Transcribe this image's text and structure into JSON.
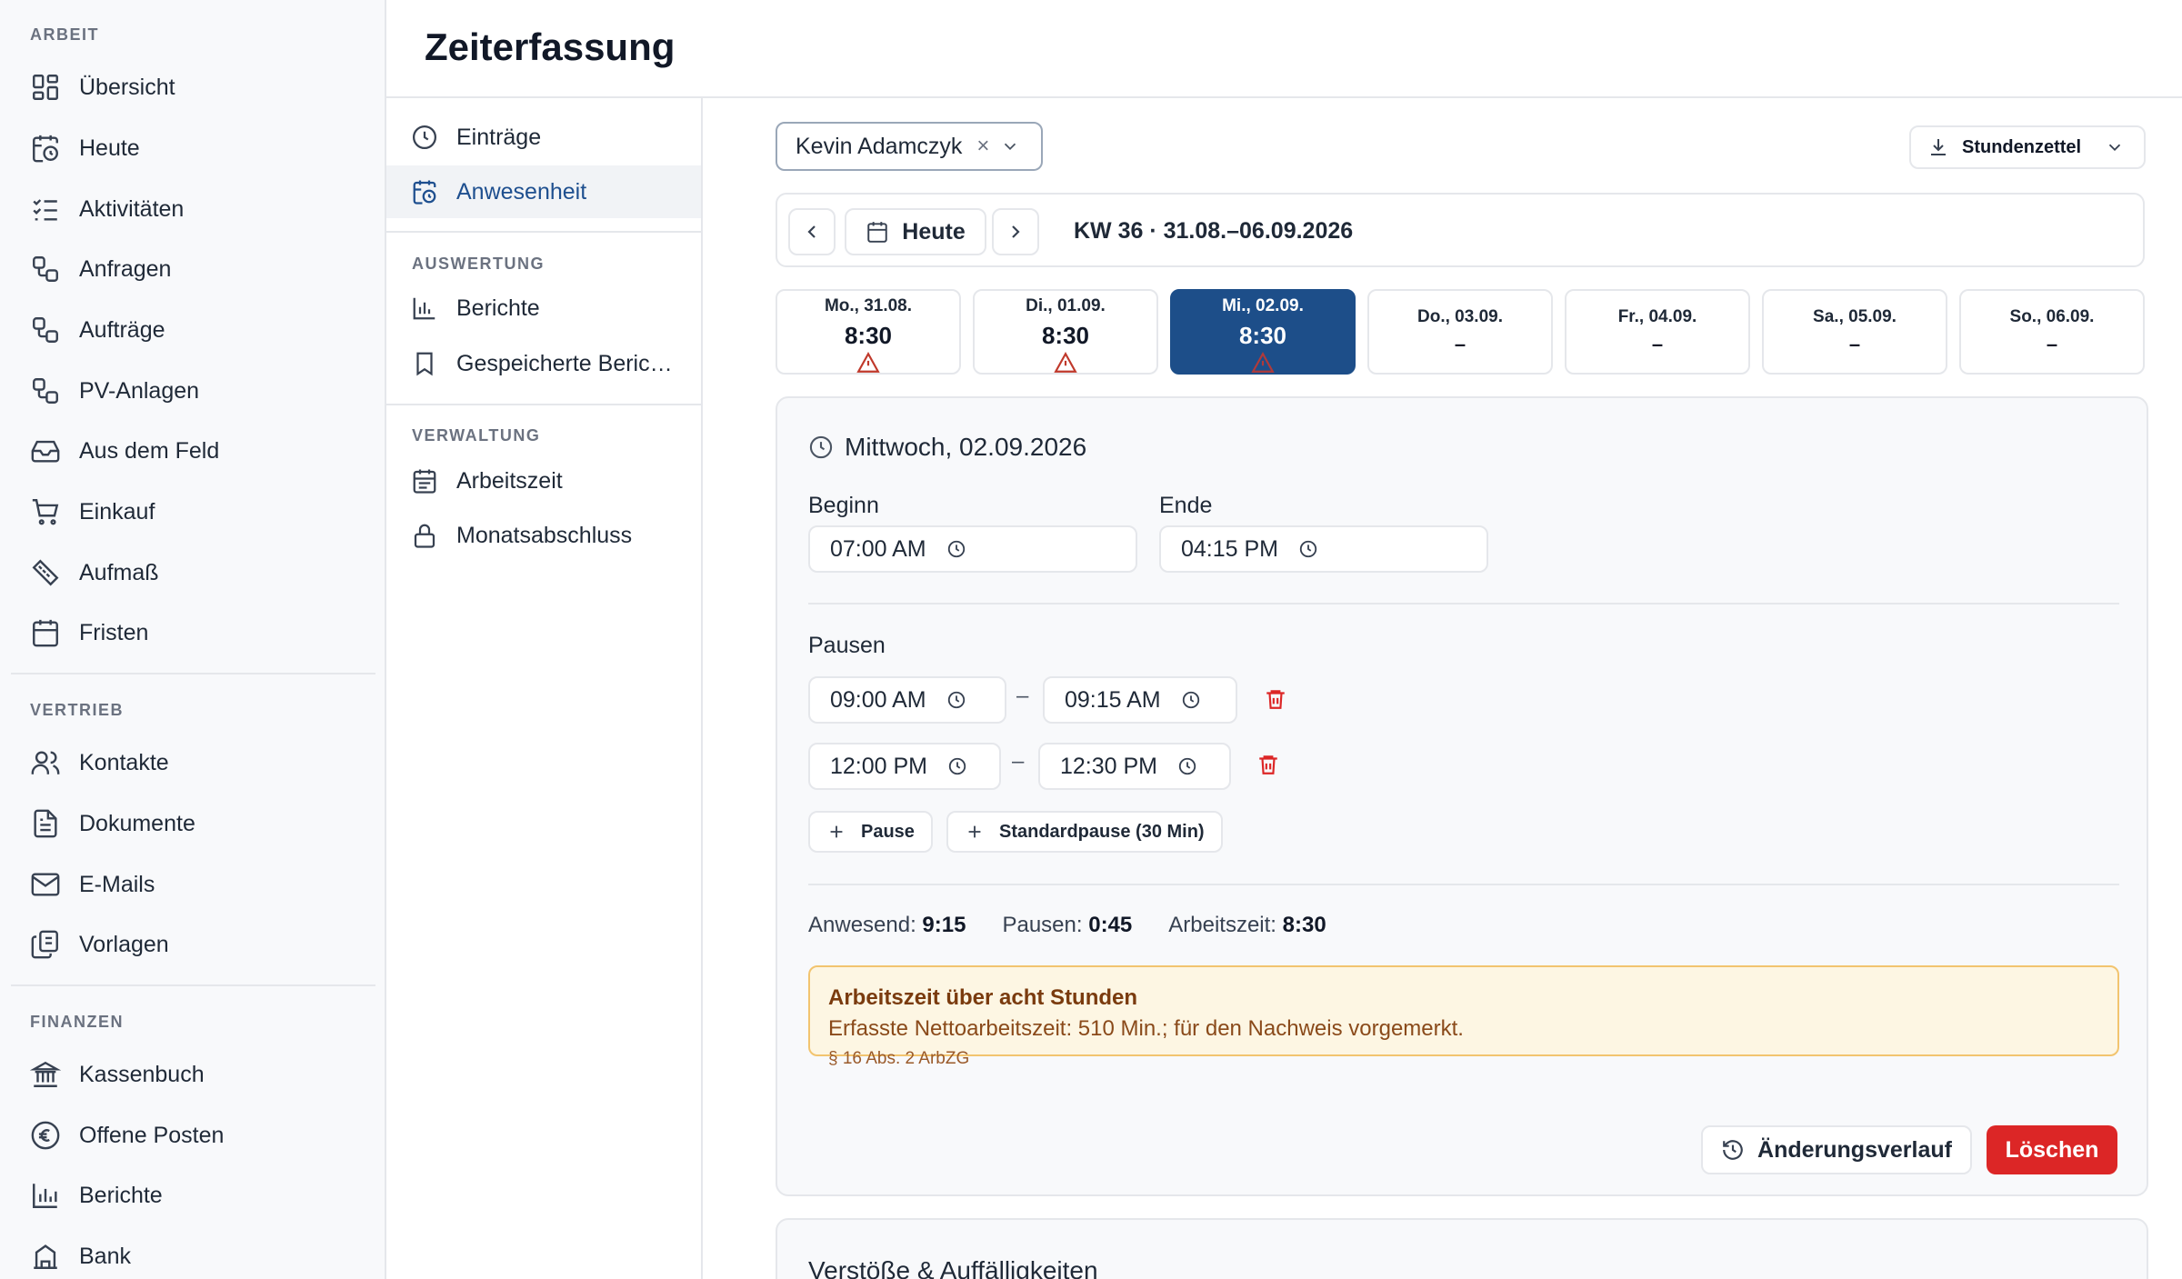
{
  "sidebar": {
    "sections": [
      {
        "title": "ARBEIT",
        "items": [
          {
            "label": "Übersicht",
            "icon": "dashboard-icon"
          },
          {
            "label": "Heute",
            "icon": "calendar-clock-icon"
          },
          {
            "label": "Aktivitäten",
            "icon": "checklist-icon"
          },
          {
            "label": "Anfragen",
            "icon": "workflow-icon"
          },
          {
            "label": "Aufträge",
            "icon": "workflow-icon"
          },
          {
            "label": "PV-Anlagen",
            "icon": "workflow-icon"
          },
          {
            "label": "Aus dem Feld",
            "icon": "inbox-icon"
          },
          {
            "label": "Einkauf",
            "icon": "cart-icon"
          },
          {
            "label": "Aufmaß",
            "icon": "ruler-icon"
          },
          {
            "label": "Fristen",
            "icon": "calendar-icon"
          }
        ]
      },
      {
        "title": "VERTRIEB",
        "items": [
          {
            "label": "Kontakte",
            "icon": "users-icon"
          },
          {
            "label": "Dokumente",
            "icon": "document-icon"
          },
          {
            "label": "E-Mails",
            "icon": "mail-icon"
          },
          {
            "label": "Vorlagen",
            "icon": "copy-icon"
          }
        ]
      },
      {
        "title": "FINANZEN",
        "items": [
          {
            "label": "Kassenbuch",
            "icon": "bank-icon"
          },
          {
            "label": "Offene Posten",
            "icon": "euro-icon"
          },
          {
            "label": "Berichte",
            "icon": "bar-chart-icon"
          },
          {
            "label": "Bank",
            "icon": "building-icon"
          }
        ]
      }
    ]
  },
  "header": {
    "title": "Zeiterfassung"
  },
  "subnav": {
    "entries": "Einträge",
    "attendance": "Anwesenheit",
    "section_eval": "AUSWERTUNG",
    "reports": "Berichte",
    "saved_reports": "Gespeicherte Beric…",
    "section_admin": "VERWALTUNG",
    "worktime": "Arbeitszeit",
    "month_close": "Monatsabschluss"
  },
  "toolbar": {
    "person": "Kevin Adamczyk",
    "clear": "×",
    "timesheet": "Stundenzettel"
  },
  "week": {
    "today": "Heute",
    "label": "KW 36 · 31.08.–06.09.2026",
    "days": [
      {
        "date": "Mo., 31.08.",
        "hours": "8:30",
        "warning": true
      },
      {
        "date": "Di., 01.09.",
        "hours": "8:30",
        "warning": true
      },
      {
        "date": "Mi., 02.09.",
        "hours": "8:30",
        "warning": true,
        "active": true
      },
      {
        "date": "Do., 03.09.",
        "hours": "–",
        "warning": false
      },
      {
        "date": "Fr., 04.09.",
        "hours": "–",
        "warning": false
      },
      {
        "date": "Sa., 05.09.",
        "hours": "–",
        "warning": false
      },
      {
        "date": "So., 06.09.",
        "hours": "–",
        "warning": false
      }
    ]
  },
  "detail": {
    "title": "Mittwoch, 02.09.2026",
    "begin_label": "Beginn",
    "begin": "07:00 AM",
    "end_label": "Ende",
    "end": "04:15 PM",
    "breaks_label": "Pausen",
    "breaks": [
      {
        "from": "09:00 AM",
        "to": "09:15 AM"
      },
      {
        "from": "12:00 PM",
        "to": "12:30 PM"
      }
    ],
    "dash": "–",
    "add_break": "Pause",
    "add_std_break": "Standardpause (30 Min)",
    "present_label": "Anwesend:",
    "present": "9:15",
    "breaks_sum_label": "Pausen:",
    "breaks_sum": "0:45",
    "worktime_label": "Arbeitszeit:",
    "worktime": "8:30",
    "alert_title": "Arbeitszeit über acht Stunden",
    "alert_msg": "Erfasste Nettoarbeitszeit: 510 Min.; für den Nachweis vorgemerkt.",
    "alert_ref": "§ 16 Abs. 2 ArbZG",
    "history": "Änderungsverlauf",
    "delete": "Löschen"
  },
  "violations": {
    "title": "Verstöße & Auffälligkeiten"
  },
  "colors": {
    "accent": "#1d4e89",
    "danger": "#dc2626",
    "warning_bg": "#fdf6e3",
    "warning_border": "#f2c46f"
  }
}
